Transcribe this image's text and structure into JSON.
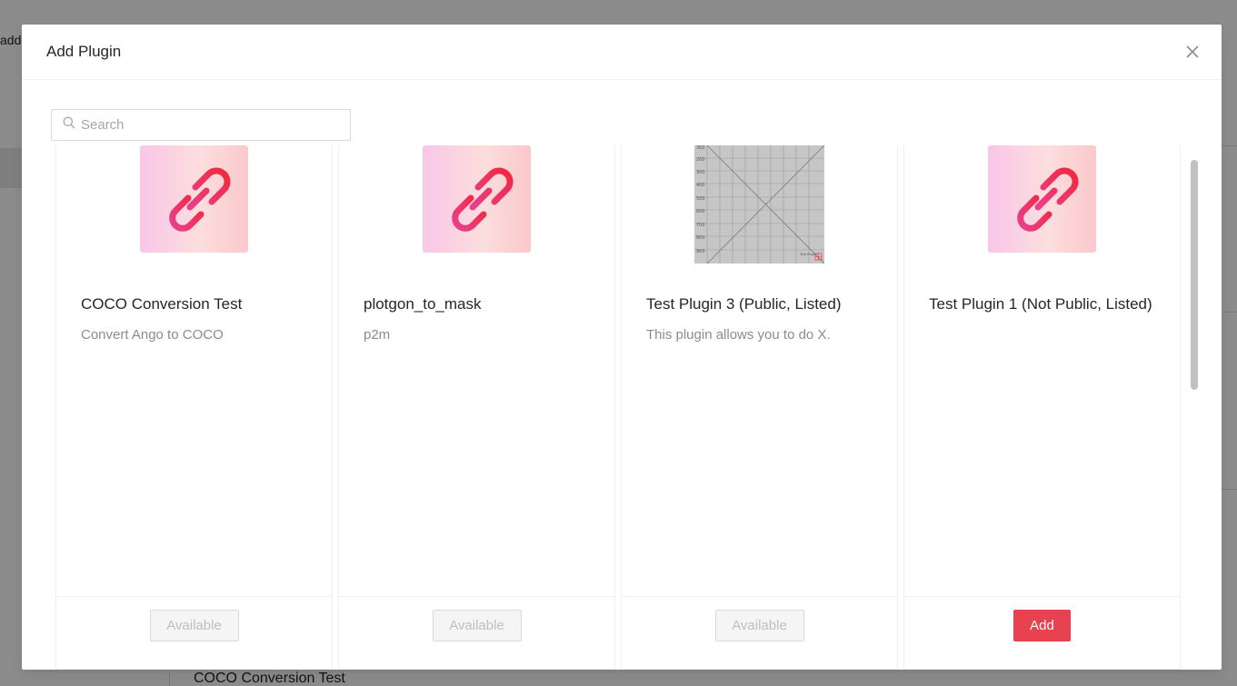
{
  "background": {
    "top_text": "add",
    "bottom_title": "COCO Conversion Test"
  },
  "modal": {
    "title": "Add Plugin",
    "close_icon": "close-icon"
  },
  "search": {
    "placeholder": "Search",
    "value": "",
    "icon": "search-icon"
  },
  "plugins": [
    {
      "title": "COCO Conversion Test",
      "description": "Convert Ango to COCO",
      "cover": "link-icon",
      "action": "Available",
      "action_enabled": false
    },
    {
      "title": "plotgon_to_mask",
      "description": "p2m",
      "cover": "link-icon",
      "action": "Available",
      "action_enabled": false
    },
    {
      "title": "Test Plugin 3 (Public, Listed)",
      "description": "This plugin allows you to do X.",
      "cover": "grid-image",
      "action": "Available",
      "action_enabled": false
    },
    {
      "title": "Test Plugin 1 (Not Public, Listed)",
      "description": "",
      "cover": "link-icon",
      "action": "Add",
      "action_enabled": true
    }
  ],
  "grid_image": {
    "y_ticks": [
      "300",
      "200",
      "300",
      "400",
      "500",
      "600",
      "700",
      "800",
      "900"
    ],
    "caption": "Test Plugin"
  },
  "colors": {
    "accent": "#e8414f",
    "logo_gradient_start": "#f9c6e8",
    "logo_gradient_end": "#fbc8cc"
  }
}
